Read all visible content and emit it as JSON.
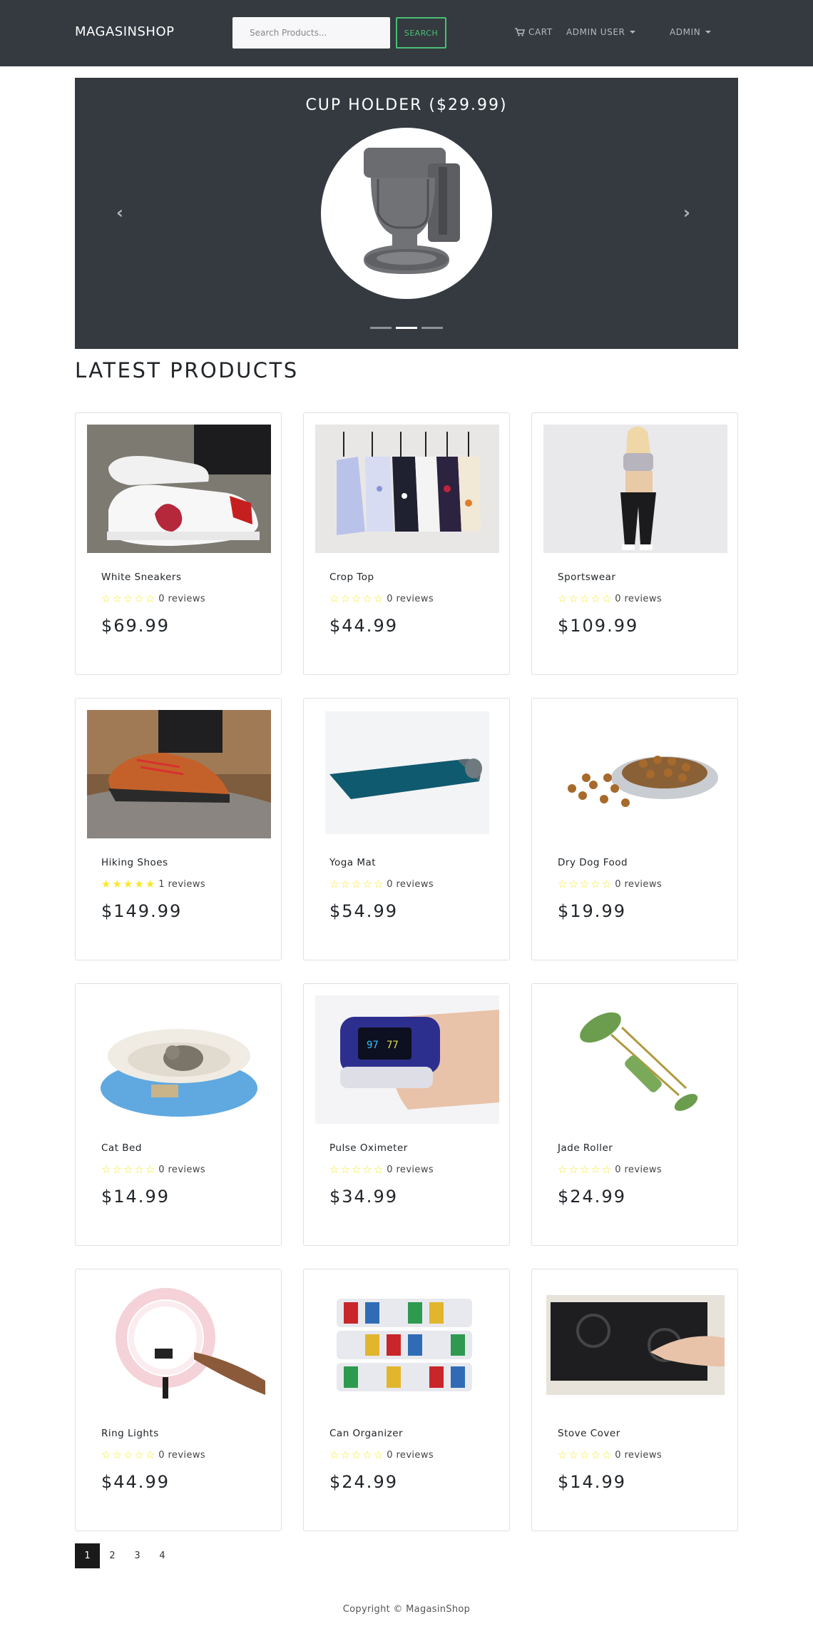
{
  "navbar": {
    "brand": "MAGASINSHOP",
    "search_placeholder": "Search Products...",
    "search_button": "SEARCH",
    "cart_label": "CART",
    "user_menu": "ADMIN USER",
    "admin_menu": "ADMIN"
  },
  "carousel": {
    "caption": "CUP HOLDER ($29.99)",
    "prev_glyph": "‹",
    "next_glyph": "›",
    "active_index": 1,
    "slide_count": 3
  },
  "section_title": "LATEST PRODUCTS",
  "products": [
    {
      "name": "White Sneakers",
      "rating": 0,
      "reviews": "0 reviews",
      "price": "$69.99"
    },
    {
      "name": "Crop Top",
      "rating": 0,
      "reviews": "0 reviews",
      "price": "$44.99"
    },
    {
      "name": "Sportswear",
      "rating": 0,
      "reviews": "0 reviews",
      "price": "$109.99"
    },
    {
      "name": "Hiking Shoes",
      "rating": 5,
      "reviews": "1 reviews",
      "price": "$149.99"
    },
    {
      "name": "Yoga Mat",
      "rating": 0,
      "reviews": "0 reviews",
      "price": "$54.99"
    },
    {
      "name": "Dry Dog Food",
      "rating": 0,
      "reviews": "0 reviews",
      "price": "$19.99"
    },
    {
      "name": "Cat Bed",
      "rating": 0,
      "reviews": "0 reviews",
      "price": "$14.99"
    },
    {
      "name": "Pulse Oximeter",
      "rating": 0,
      "reviews": "0 reviews",
      "price": "$34.99"
    },
    {
      "name": "Jade Roller",
      "rating": 0,
      "reviews": "0 reviews",
      "price": "$24.99"
    },
    {
      "name": "Ring Lights",
      "rating": 0,
      "reviews": "0 reviews",
      "price": "$44.99"
    },
    {
      "name": "Can Organizer",
      "rating": 0,
      "reviews": "0 reviews",
      "price": "$24.99"
    },
    {
      "name": "Stove Cover",
      "rating": 0,
      "reviews": "0 reviews",
      "price": "$14.99"
    }
  ],
  "pagination": {
    "pages": [
      "1",
      "2",
      "3",
      "4"
    ],
    "active": "1"
  },
  "footer": "Copyright © MagasinShop",
  "colors": {
    "navbar_bg": "#343a40",
    "accent_green": "#4bbf73",
    "star_yellow": "#f8e825"
  }
}
